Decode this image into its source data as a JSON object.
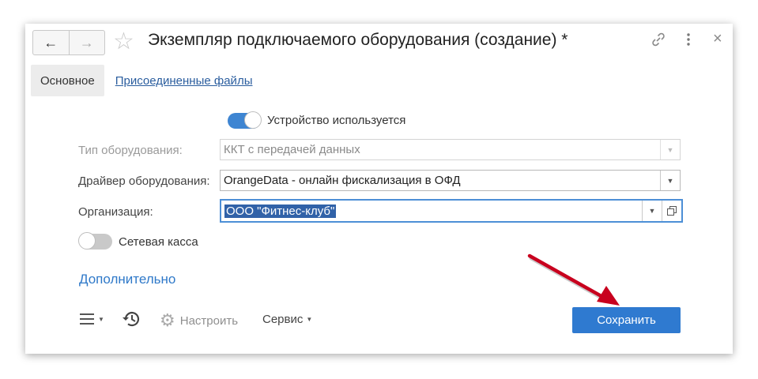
{
  "header": {
    "title": "Экземпляр подключаемого оборудования (создание) *",
    "back_icon": "arrow-left-icon",
    "forward_icon": "arrow-right-icon",
    "favorite_icon": "star-icon",
    "link_icon": "link-icon",
    "more_icon": "kebab-menu-icon",
    "close_icon": "close-icon"
  },
  "tabs": [
    {
      "label": "Основное",
      "active": true
    },
    {
      "label": "Присоединенные файлы",
      "active": false
    }
  ],
  "form": {
    "device_used": {
      "label": "Устройство используется",
      "on": true
    },
    "equipment_type": {
      "label": "Тип оборудования:",
      "value": "ККТ с передачей данных",
      "disabled": true
    },
    "driver": {
      "label": "Драйвер оборудования:",
      "value": "OrangeData - онлайн фискализация в ОФД"
    },
    "organization": {
      "label": "Организация:",
      "value": "ООО \"Фитнес-клуб\"",
      "focused": true
    },
    "network_register": {
      "label": "Сетевая касса",
      "on": false
    },
    "more_link": "Дополнительно"
  },
  "footer": {
    "menu_icon": "hamburger-menu-icon",
    "history_icon": "history-icon",
    "settings_icon": "gear-icon",
    "configure_label": "Настроить",
    "service_label": "Сервис",
    "save_label": "Сохранить"
  },
  "colors": {
    "accent": "#2f7ad0",
    "link": "#2a5d9e",
    "toggle_on": "#3e85d2",
    "selection": "#3162a8",
    "annotation_arrow": "#c8001e"
  }
}
